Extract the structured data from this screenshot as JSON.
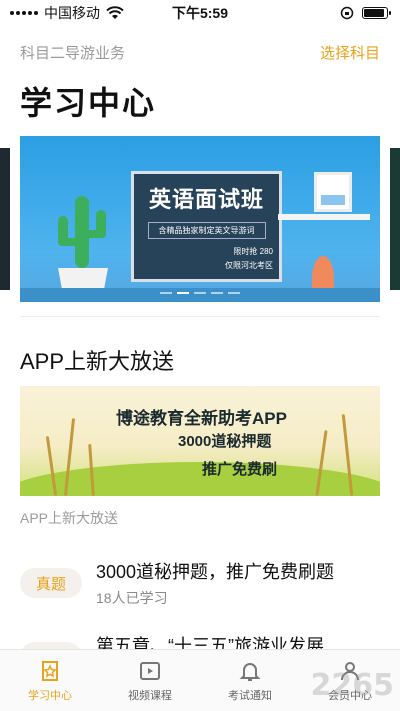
{
  "status_bar": {
    "carrier": "中国移动",
    "time": "下午5:59"
  },
  "header": {
    "subject": "科目二导游业务",
    "select_label": "选择科目",
    "page_title": "学习中心"
  },
  "carousel": {
    "slide_title": "英语面试班",
    "slide_subtitle": "含精品独家制定英文导游词",
    "slide_promo_line1": "限时抢  280",
    "slide_promo_line2": "仅限河北考区"
  },
  "promo_section": {
    "title": "APP上新大放送",
    "banner_line1": "博途教育全新助考APP",
    "banner_line2": "3000道秘押题",
    "banner_line3": "推广免费刷",
    "caption": "APP上新大放送"
  },
  "list": [
    {
      "tag": "真题",
      "title": "3000道秘押题，推广免费刷题",
      "meta": "18人已学习"
    },
    {
      "tag": "",
      "title": "第五章、“十三五”旅游业发展…",
      "meta": ""
    }
  ],
  "tabs": [
    {
      "label": "学习中心",
      "icon": "star-doc-icon",
      "active": true
    },
    {
      "label": "视频课程",
      "icon": "video-icon",
      "active": false
    },
    {
      "label": "考试通知",
      "icon": "bell-icon",
      "active": false
    },
    {
      "label": "会员中心",
      "icon": "user-icon",
      "active": false
    }
  ],
  "watermark": "2265",
  "colors": {
    "accent": "#e8a21c",
    "muted": "#9a9a9a"
  }
}
